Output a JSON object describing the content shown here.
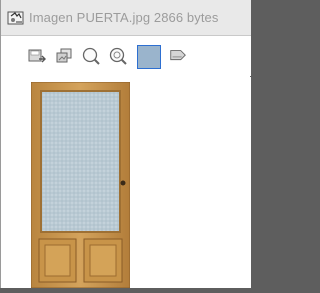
{
  "window": {
    "title": "Imagen PUERTA.jpg  2866 bytes"
  },
  "toolbar": {
    "buttons": [
      {
        "name": "save-image-button",
        "icon": "disk-arrow-icon"
      },
      {
        "name": "copy-image-button",
        "icon": "copy-icon"
      },
      {
        "name": "zoom-in-button",
        "icon": "magnifier-icon"
      },
      {
        "name": "zoom-fit-button",
        "icon": "magnifier-search-icon"
      },
      {
        "name": "background-color-button",
        "icon": "color-swatch-icon",
        "active": true
      },
      {
        "name": "flip-button",
        "icon": "flip-arrow-icon"
      }
    ]
  },
  "image": {
    "subject": "door-image",
    "colors": {
      "wood": "#c9994f",
      "glass": "#b8c8d2",
      "swatch": "#9ab4cc",
      "accent_border": "#2d6fd1"
    }
  }
}
